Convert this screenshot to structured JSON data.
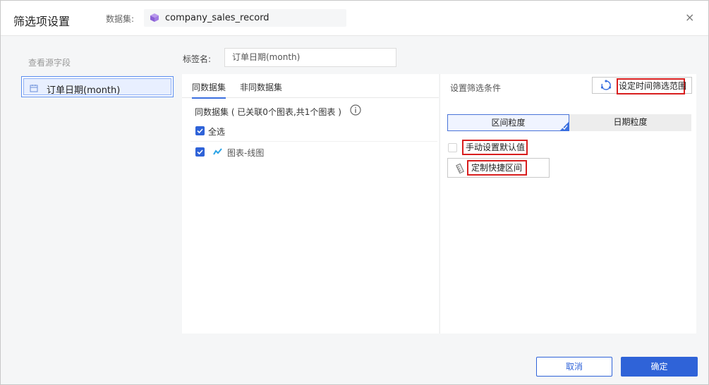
{
  "dialog": {
    "title": "筛选项设置",
    "dataset_label": "数据集:",
    "dataset_name": "company_sales_record",
    "close_glyph": "×"
  },
  "left_panel": {
    "title": "查看源字段",
    "field": "订单日期(month)"
  },
  "label_row": {
    "label": "标签名:",
    "value": "订单日期(month)"
  },
  "tabs": [
    {
      "label": "同数据集",
      "active": true
    },
    {
      "label": "非同数据集",
      "active": false
    }
  ],
  "same_dataset": {
    "text": "同数据集 ( 已关联0个图表,共1个图表 )",
    "select_all": "全选",
    "select_all_checked": true,
    "chart_item": "图表-线图",
    "chart_item_checked": true
  },
  "conditions": {
    "title": "设置筛选条件",
    "time_range_button": "设定时间筛选范围",
    "granularity_options": [
      "区间粒度",
      "日期粒度"
    ],
    "granularity_selected": "区间粒度",
    "manual_default": "手动设置默认值",
    "manual_default_checked": false,
    "quick_range_button": "定制快捷区间"
  },
  "footer": {
    "cancel": "取消",
    "ok": "确定"
  },
  "colors": {
    "primary": "#2f63d8",
    "highlight_border": "#d81e1e",
    "dataset_icon": "#9b6fdc"
  },
  "icons": {
    "dataset": "cube-icon",
    "field": "calendar-icon",
    "info": "info-icon",
    "chart": "line-chart-icon",
    "time_range": "refresh-icon",
    "quick_range": "ruler-icon"
  }
}
